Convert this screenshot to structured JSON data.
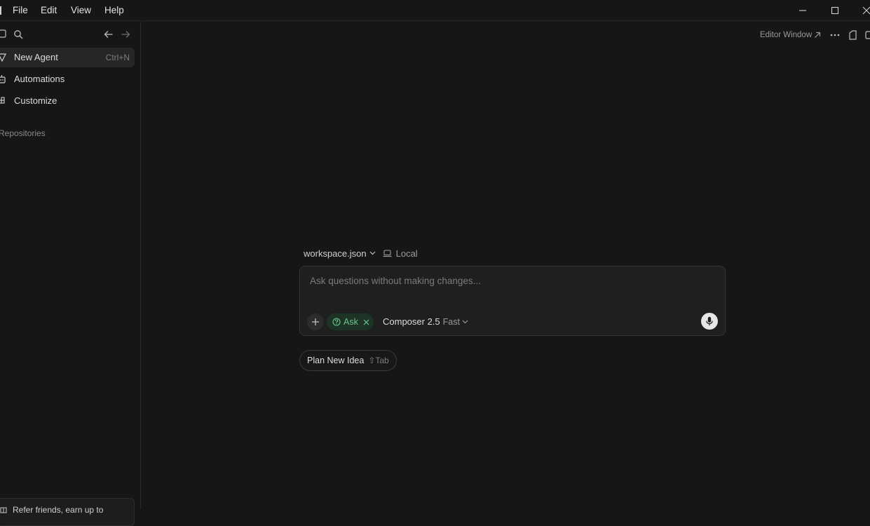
{
  "menu": {
    "file": "File",
    "edit": "Edit",
    "view": "View",
    "help": "Help"
  },
  "sidebar": {
    "items": [
      {
        "label": "New Agent",
        "shortcut": "Ctrl+N",
        "icon": "agent-icon",
        "active": true
      },
      {
        "label": "Automations",
        "icon": "robot-icon"
      },
      {
        "label": "Customize",
        "icon": "blocks-icon"
      }
    ],
    "section_label": "Repositories",
    "refer_text": "Refer friends, earn up to"
  },
  "toolbar": {
    "editor_window": "Editor Window",
    "more_icon": "more-icon"
  },
  "composer": {
    "workspace": "workspace.json",
    "location": "Local",
    "placeholder": "Ask questions without making changes...",
    "mode_label": "Ask",
    "model_name": "Composer 2.5",
    "model_variant": "Fast"
  },
  "suggestion": {
    "label": "Plan New Idea",
    "shortcut": "⇧Tab"
  },
  "colors": {
    "background": "#161616",
    "composer_bg": "#1f1f1f",
    "ask_accent": "#6ac88f",
    "ask_bg": "#1c3326"
  }
}
